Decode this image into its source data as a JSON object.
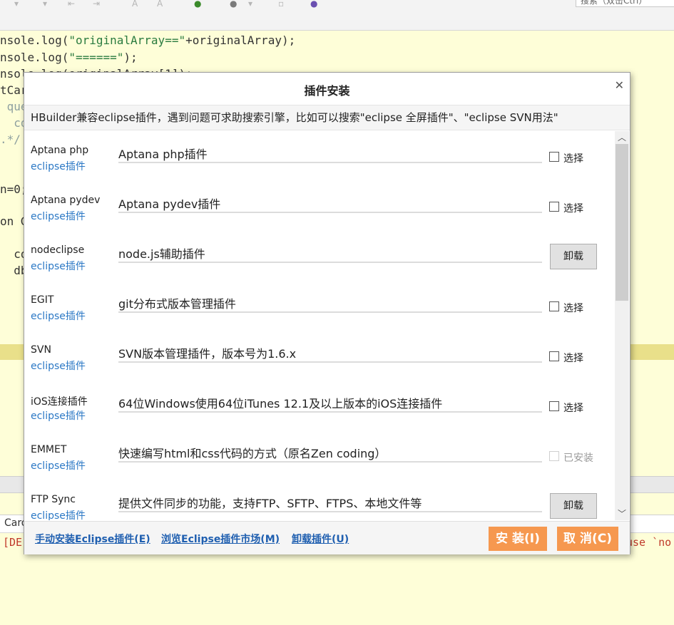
{
  "toolbar": {
    "search_placeholder": "搜索（双击Ctrl）"
  },
  "editor": {
    "lines": [
      {
        "pre": "nsole.log(",
        "str": "\"originalArray==\"",
        "post": "+originalArray);"
      },
      {
        "pre": "nsole.log(",
        "str": "\"======\"",
        "post": ");"
      },
      {
        "pre": "nsole.log(originalArray[1]);",
        "str": "",
        "post": ""
      }
    ],
    "fragments": [
      {
        "text": "tCar",
        "kind": "code"
      },
      {
        "text": " que",
        "kind": "cmt"
      },
      {
        "text": "  co",
        "kind": "cmt"
      },
      {
        "text": ".*/",
        "kind": "cmt"
      },
      {
        "text": "n=0;",
        "kind": "code"
      },
      {
        "text": "on G",
        "kind": "code"
      },
      {
        "text": "  co",
        "kind": "code"
      },
      {
        "text": "  db",
        "kind": "code"
      }
    ]
  },
  "bottom_panel": {
    "tab_label": "Caro",
    "console_left": "[DE",
    "console_right": "use `no"
  },
  "dialog": {
    "title": "插件安装",
    "hint": "HBuilder兼容eclipse插件，遇到问题可求助搜索引擎，比如可以搜索\"eclipse 全屏插件\"、\"eclipse SVN用法\"",
    "plugins": [
      {
        "name": "Aptana php",
        "link": "eclipse插件",
        "desc": "Aptana php插件",
        "action": "checkbox",
        "action_label": "选择"
      },
      {
        "name": "Aptana pydev",
        "link": "eclipse插件",
        "desc": "Aptana pydev插件",
        "action": "checkbox",
        "action_label": "选择"
      },
      {
        "name": "nodeclipse",
        "link": "eclipse插件",
        "desc": "node.js辅助插件",
        "action": "button",
        "action_label": "卸载"
      },
      {
        "name": "EGIT",
        "link": "eclipse插件",
        "desc": "git分布式版本管理插件",
        "action": "checkbox",
        "action_label": "选择"
      },
      {
        "name": "SVN",
        "link": "eclipse插件",
        "desc": "SVN版本管理插件，版本号为1.6.x",
        "action": "checkbox",
        "action_label": "选择"
      },
      {
        "name": "iOS连接插件",
        "link": "eclipse插件",
        "desc": "64位Windows使用64位iTunes 12.1及以上版本的iOS连接插件",
        "action": "checkbox",
        "action_label": "选择"
      },
      {
        "name": "EMMET",
        "link": "eclipse插件",
        "desc": "快速编写html和css代码的方式（原名Zen coding）",
        "action": "installed",
        "action_label": "已安装"
      },
      {
        "name": "FTP Sync",
        "link": "eclipse插件",
        "desc": "提供文件同步的功能，支持FTP、SFTP、FTPS、本地文件等",
        "action": "button",
        "action_label": "卸载"
      }
    ],
    "footer": {
      "manual_install": "手动安装Eclipse插件(E)",
      "browse_market": "浏览Eclipse插件市场(M)",
      "uninstall": "卸载插件(U)",
      "install_button": "安 装(I)",
      "cancel_button": "取 消(C)"
    }
  }
}
